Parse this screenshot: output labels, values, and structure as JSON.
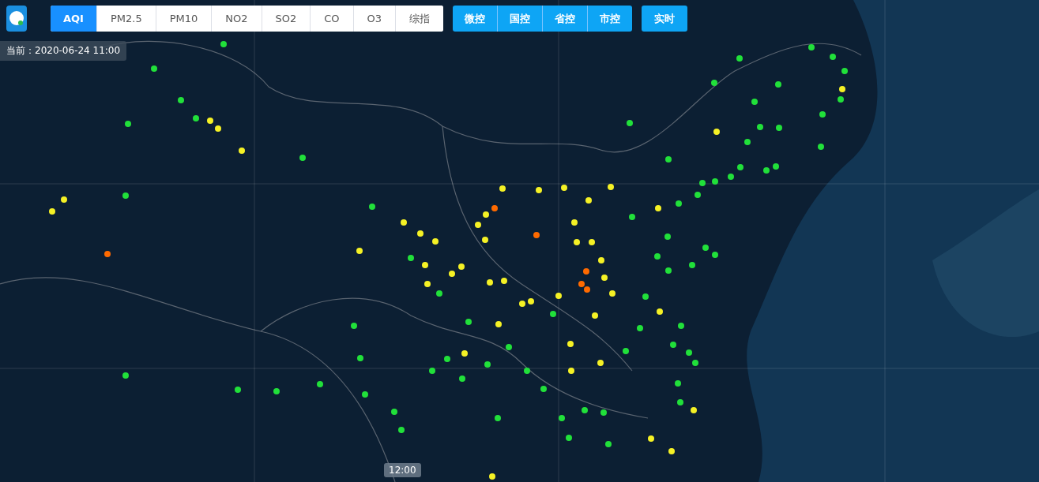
{
  "pollutant_tabs": [
    {
      "label": "AQI",
      "selected": true
    },
    {
      "label": "PM2.5",
      "selected": false
    },
    {
      "label": "PM10",
      "selected": false
    },
    {
      "label": "NO2",
      "selected": false
    },
    {
      "label": "SO2",
      "selected": false
    },
    {
      "label": "CO",
      "selected": false
    },
    {
      "label": "O3",
      "selected": false
    },
    {
      "label": "综指",
      "selected": false
    }
  ],
  "station_tabs": [
    {
      "label": "微控",
      "selected": true
    },
    {
      "label": "国控",
      "selected": true
    },
    {
      "label": "省控",
      "selected": true
    },
    {
      "label": "市控",
      "selected": true
    }
  ],
  "realtime_button": {
    "label": "实时",
    "selected": true
  },
  "current_time": "当前：2020-06-24 11:00",
  "timeline_marker": "12:00"
}
